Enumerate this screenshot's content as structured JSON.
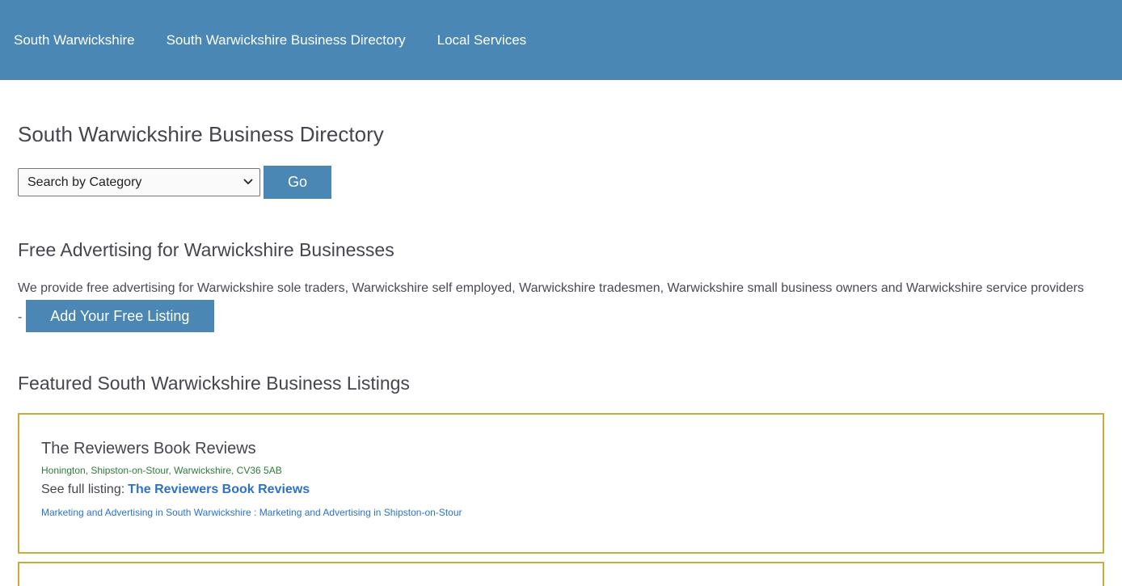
{
  "nav": {
    "items": [
      "South Warwickshire",
      "South Warwickshire Business Directory",
      "Local Services"
    ]
  },
  "main": {
    "title": "South Warwickshire Business Directory",
    "category_select": "Search by Category",
    "go_label": "Go",
    "free_heading": "Free Advertising for Warwickshire Businesses",
    "free_text": "We provide free advertising for Warwickshire sole traders, Warwickshire self employed, Warwickshire tradesmen, Warwickshire small business owners and Warwickshire service providers -",
    "add_label": "Add Your Free Listing",
    "featured_heading": "Featured South Warwickshire Business Listings"
  },
  "listings": [
    {
      "name": "The Reviewers Book Reviews",
      "address": "Honington, Shipston-on-Stour, Warwickshire, CV36 5AB",
      "full_prefix": "See full listing:",
      "full_link": "The Reviewers Book Reviews",
      "cat1": "Marketing and Advertising in South Warwickshire",
      "cat_sep": " : ",
      "cat2": "Marketing and Advertising in Shipston-on-Stour"
    }
  ],
  "colors": {
    "header": "#4a87b4",
    "button": "#4a87b4",
    "listing_border": "#c9ad3c",
    "link": "#2d72c8",
    "address": "#2f7a3a"
  },
  "icons": {
    "select_chevron": "chevron-down-icon"
  }
}
